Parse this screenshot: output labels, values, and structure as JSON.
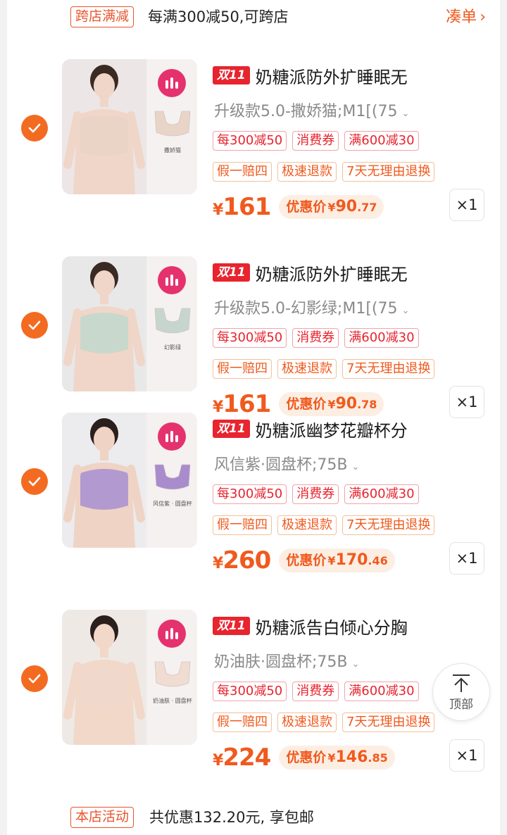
{
  "promo": {
    "tag": "跨店满减",
    "text": "每满300减50,可跨店",
    "link": "凑单"
  },
  "items": [
    {
      "badge": "双11",
      "title": "奶糖派防外扩睡眠无",
      "variant": "升级款5.0-撒娇猫;M1[(75",
      "panel_caption": "撒娇猫",
      "promo_tags": [
        "每300减50",
        "消费券",
        "满600减30"
      ],
      "service_tags": [
        "假一赔四",
        "极速退款",
        "7天无理由退换"
      ],
      "price": "161",
      "deal_label": "优惠价",
      "deal_int": "90",
      "deal_dec": ".77",
      "qty": "×1"
    },
    {
      "badge": "双11",
      "title": "奶糖派防外扩睡眠无",
      "variant": "升级款5.0-幻影绿;M1[(75",
      "panel_caption": "幻影绿",
      "promo_tags": [
        "每300减50",
        "消费券",
        "满600减30"
      ],
      "service_tags": [
        "假一赔四",
        "极速退款",
        "7天无理由退换"
      ],
      "price": "161",
      "deal_label": "优惠价",
      "deal_int": "90",
      "deal_dec": ".78",
      "qty": "×1"
    },
    {
      "badge": "双11",
      "title": "奶糖派幽梦花瓣杯分",
      "variant": "风信紫·圆盘杯;75B",
      "panel_caption": "风信紫 · 圆盘杯",
      "promo_tags": [
        "每300减50",
        "消费券",
        "满600减30"
      ],
      "service_tags": [
        "假一赔四",
        "极速退款",
        "7天无理由退换"
      ],
      "price": "260",
      "deal_label": "优惠价",
      "deal_int": "170",
      "deal_dec": ".46",
      "qty": "×1"
    },
    {
      "badge": "双11",
      "title": "奶糖派告白倾心分胸",
      "variant": "奶油肤·圆盘杯;75B",
      "panel_caption": "奶油肤 · 圆盘杯",
      "promo_tags": [
        "每300减50",
        "消费券",
        "满600减30"
      ],
      "service_tags": [
        "假一赔四",
        "极速退款",
        "7天无理由退换"
      ],
      "price": "224",
      "deal_label": "优惠价",
      "deal_int": "146",
      "deal_dec": ".85",
      "qty": "×1"
    }
  ],
  "currency": "¥",
  "back_to_top": "顶部",
  "store_activity": {
    "tag": "本店活动",
    "text": "共优惠132.20元, 享包邮"
  },
  "colors": {
    "accent": "#f05a1e",
    "check": "#f36b21",
    "badge_red": "#e8242e",
    "brand_logo": "#e5326e"
  }
}
